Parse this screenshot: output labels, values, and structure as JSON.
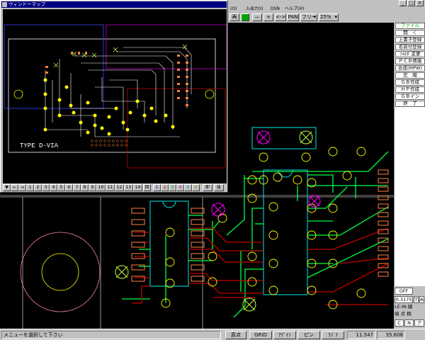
{
  "titlebar": {
    "app_icon": "gb-app-icon",
    "win_min": "_",
    "win_max": "□",
    "win_close": "×"
  },
  "menubar": {
    "items": [
      "(O)",
      "入出力(I)",
      "DSN",
      "ヘルプ(H)"
    ]
  },
  "toolbar": {
    "buttons": [
      "再",
      "",
      "—",
      "+",
      "<->",
      "PAN",
      "フリー",
      "25%"
    ]
  },
  "command_panel": {
    "header": "ファイル",
    "items": [
      "開　く",
      "上書き登録",
      "名前付登録",
      "ﾌｫﾙﾀﾞ変更",
      "ＰＣＢ情報",
      "合成(MPW)",
      "圧　縮",
      "ＧＢ作成",
      "ＨＰ作成",
      "ＧＢイン",
      "終　了"
    ]
  },
  "status_panel": {
    "mode": "OFF",
    "width_value": "0.3175",
    "t_label": "T",
    "a_label": "A",
    "le_in": "LE-IN 線",
    "points": "端 点 相",
    "c_label": "C",
    "n_label": "N",
    "a2_label": "ア"
  },
  "statusbar": {
    "message": "メニューを選択して下さい",
    "buttons": [
      "原点",
      "GRID",
      "ｱﾃﾞｲﾝ",
      "ピン",
      "ﾗｼﾞﾃ"
    ],
    "x": "11.547",
    "y": "35.608"
  },
  "overview": {
    "title": "ウィンドーマップ",
    "board_label": "TYPE D-VIA",
    "layer_buttons": [
      "▼",
      "←",
      "→",
      "1",
      "2",
      "3",
      "4",
      "5",
      "6",
      "7",
      "8",
      "9",
      "10",
      "11",
      "12",
      "13",
      "14",
      "回",
      "1",
      "2",
      "3",
      "4",
      "5",
      "6",
      "即",
      "抜"
    ]
  },
  "colors": {
    "trace_green": "#00ff40",
    "trace_red": "#c00000",
    "pad_yellow": "#ffff00",
    "outline_cyan": "#00c0c0",
    "via_magenta": "#ff00ff",
    "pad_orange": "#ff8040"
  }
}
